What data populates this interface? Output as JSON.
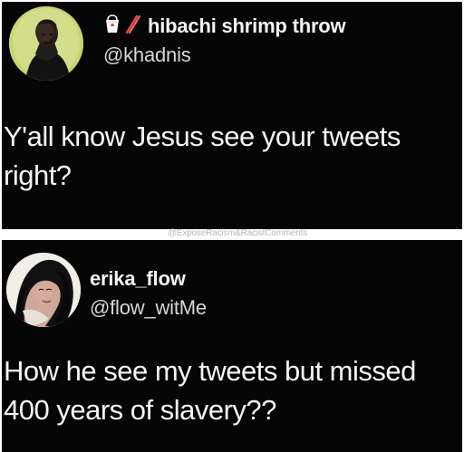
{
  "tweet_1": {
    "display_name": "hibachi shrimp throw",
    "handle": "@khadnis",
    "text_lines": [
      "Y'all know Jesus see your tweets",
      "right?"
    ],
    "icon_names": [
      "takeout-box-icon",
      "chopsticks-icon"
    ],
    "colors": {
      "card_background": "#050505",
      "text": "#f5f5f5"
    }
  },
  "watermark": {
    "text": "@ExposeRacism&RacistComments"
  },
  "tweet_2": {
    "display_name": "erika_flow",
    "handle": "@flow_witMe",
    "text_lines": [
      "How he see my tweets but missed",
      "400 years of slavery??"
    ],
    "colors": {
      "card_background": "#050505",
      "text": "#f5f5f5"
    }
  }
}
